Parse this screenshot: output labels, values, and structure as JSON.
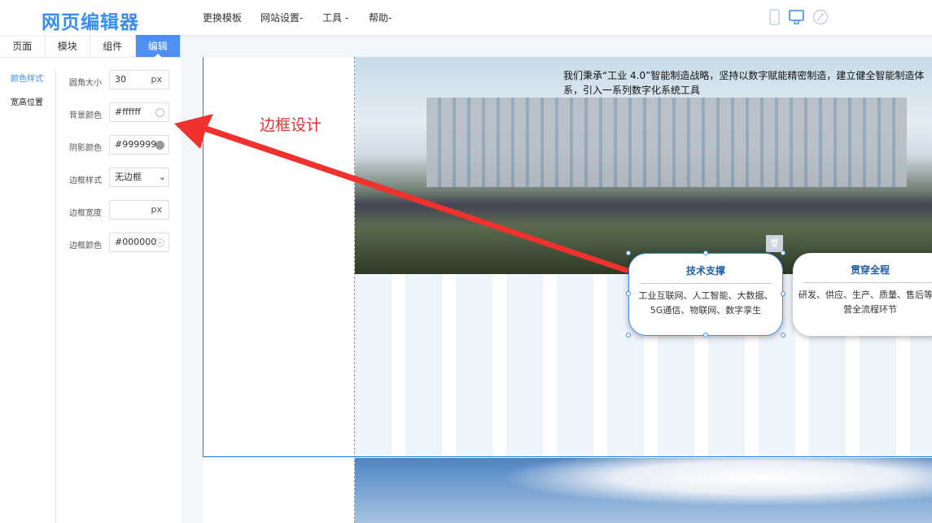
{
  "header": {
    "logo": "网页编辑器",
    "nav": [
      "更换模板",
      "网站设置-",
      "工具 -",
      "帮助-"
    ]
  },
  "tabs": [
    "页面",
    "模块",
    "组件",
    "编辑"
  ],
  "subnav": [
    "颜色样式",
    "宽高位置"
  ],
  "form": [
    {
      "label": "圆角大小",
      "value": "30",
      "unit": "px"
    },
    {
      "label": "背景颜色",
      "value": "#ffffff",
      "swatch": "#ffffff"
    },
    {
      "label": "阴影颜色",
      "value": "#999999",
      "swatch": "#999999"
    },
    {
      "label": "边框样式",
      "value": "无边框"
    },
    {
      "label": "边框宽度",
      "value": "",
      "unit": "px"
    },
    {
      "label": "边框颜色",
      "value": "#000000"
    }
  ],
  "annotation": "边框设计",
  "content": {
    "description": "我们秉承“工业 4.0”智能制造战略，坚持以数字赋能精密制造，建立健全智能制造体系，引入一系列数字化系统工具",
    "cards": [
      {
        "title": "技术支撑",
        "text": "工业互联网、人工智能、大数据、5G通信、物联网、数字孪生"
      },
      {
        "title": "贯穿全程",
        "text": "研发、供应、生产、质量、售后等运营全流程环节"
      }
    ]
  },
  "colors": {
    "accent": "#4f90f5",
    "annotation": "#e63030"
  }
}
